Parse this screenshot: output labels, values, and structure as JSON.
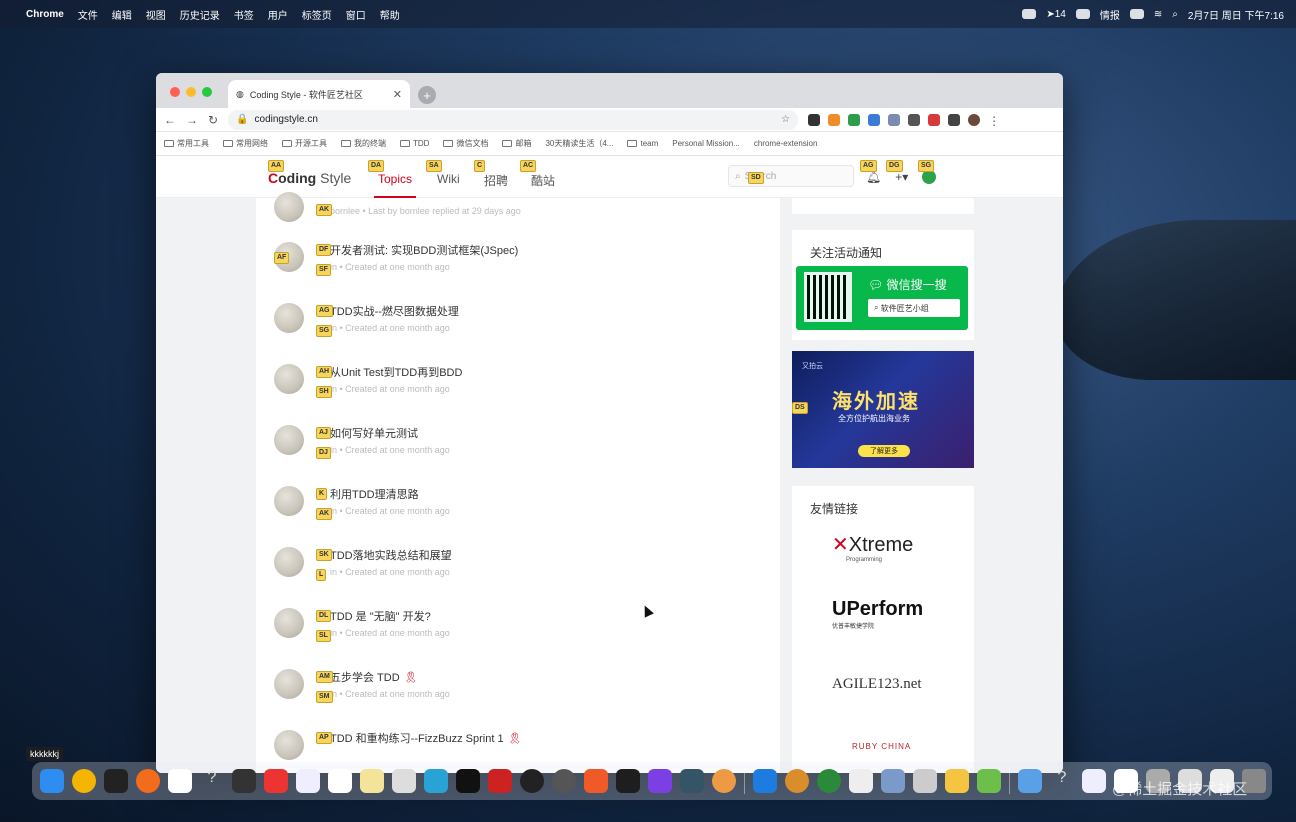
{
  "menubar": {
    "app_name": "Chrome",
    "items": [
      "文件",
      "编辑",
      "视图",
      "历史记录",
      "书签",
      "用户",
      "标签页",
      "窗口",
      "帮助"
    ],
    "status_temp": "14",
    "status_label": "情报",
    "clock": "2月7日 周日 下午7:16"
  },
  "browser": {
    "tab_title": "Coding Style - 软件匠艺社区",
    "url": "codingstyle.cn",
    "bookmarks": [
      "常用工具",
      "常用网络",
      "开源工具",
      "我的终端",
      "TDD",
      "微信文档",
      "邮箱",
      "30天精读生活（4...",
      "team",
      "Personal Mission...",
      "chrome-extension"
    ]
  },
  "site": {
    "logo_c": "C",
    "logo_rest": "oding",
    "logo_style": "Style",
    "nav": [
      "Topics",
      "Wiki",
      "招聘",
      "酷站"
    ],
    "search_placeholder": "Search"
  },
  "topics": [
    {
      "title": "",
      "meta": "bornlee • Last by bornlee replied at 29 days ago",
      "award": false
    },
    {
      "title": "开发者测试: 实现BDD测试框架(JSpec)",
      "meta": "in • Created at one month ago",
      "award": false
    },
    {
      "title": "TDD实战--燃尽图数据处理",
      "meta": "in • Created at one month ago",
      "award": false
    },
    {
      "title": "从Unit Test到TDD再到BDD",
      "meta": "in • Created at one month ago",
      "award": false
    },
    {
      "title": "如何写好单元测试",
      "meta": "in • Created at one month ago",
      "award": false
    },
    {
      "title": "利用TDD理清思路",
      "meta": "in • Created at one month ago",
      "award": false
    },
    {
      "title": "TDD落地实践总结和展望",
      "meta": "in • Created at one month ago",
      "award": false
    },
    {
      "title": "TDD 是 \"无脑\" 开发?",
      "meta": "in • Created at one month ago",
      "award": false
    },
    {
      "title": "五步学会 TDD",
      "meta": "in • Created at one month ago",
      "award": true
    },
    {
      "title": "TDD 和重构练习--FizzBuzz Sprint 1",
      "meta": "",
      "award": true
    }
  ],
  "sidebar": {
    "notice_title": "关注活动通知",
    "wechat_title": "微信搜一搜",
    "wechat_search": "软件匠艺小组",
    "ad_brand": "又拍云",
    "ad_headline": "海外加速",
    "ad_sub": "全方位护航出海业务",
    "ad_button": "了解更多",
    "friends_title": "友情链接",
    "partner_1": "Xtreme",
    "partner_1_sub": "Programming",
    "partner_2": "UPerform",
    "partner_2_sub": "优普丰敏捷学院",
    "partner_3": "AGILE123.net",
    "partner_4": "RUBY CHINA"
  },
  "vimium_hints": [
    "AA",
    "AK",
    "DA",
    "SA",
    "C",
    "AC",
    "AG",
    "DG",
    "SG",
    "SD",
    "DF",
    "AF",
    "SF",
    "AG",
    "SG",
    "AH",
    "SH",
    "AJ",
    "DJ",
    "K",
    "AK",
    "SK",
    "L",
    "DL",
    "SL",
    "AM",
    "SM",
    "AP",
    "DS"
  ],
  "dock_tooltip": "kkkkkkj",
  "watermark": "@稀土掘金技术社区",
  "colors": {
    "accent": "#d0021b",
    "wechat_green": "#08b84b",
    "hint_yellow": "#f6d55a"
  }
}
